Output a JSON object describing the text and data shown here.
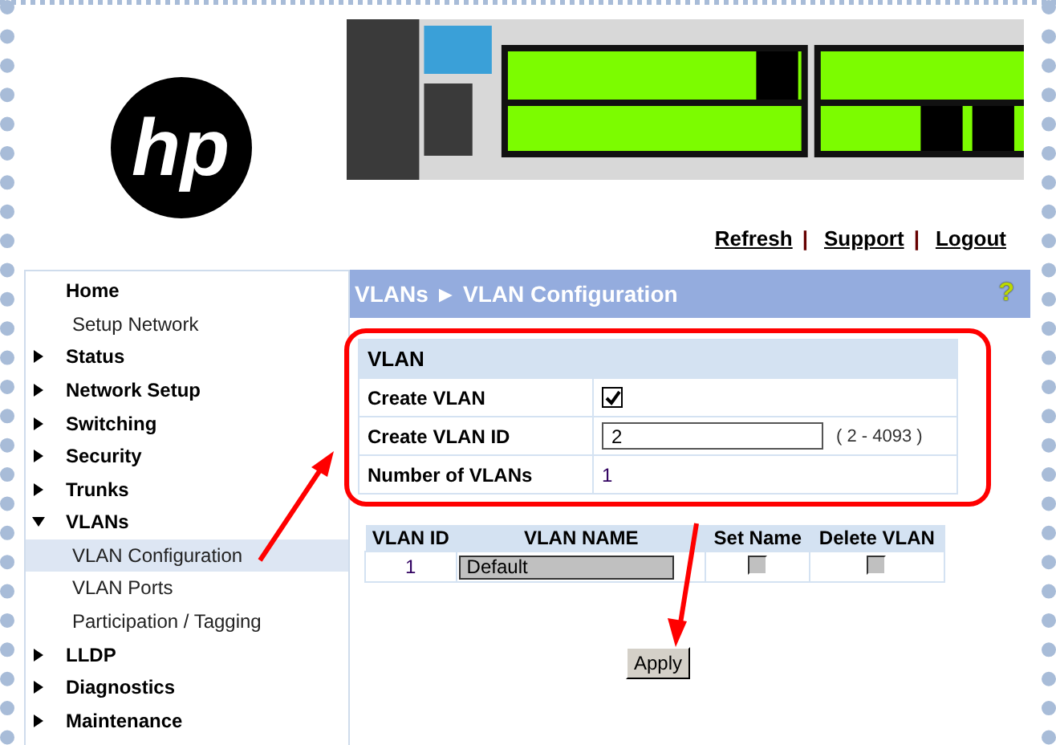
{
  "logo": "hp",
  "header_links": [
    {
      "label": "Refresh"
    },
    {
      "label": "Support"
    },
    {
      "label": "Logout"
    }
  ],
  "link_separator": "|",
  "sidebar": {
    "items": [
      {
        "label": "Home",
        "kind": "plain",
        "selected": false,
        "children": [
          {
            "label": "Setup Network",
            "selected": false
          }
        ]
      },
      {
        "label": "Status",
        "kind": "arrow",
        "expanded": false,
        "selected": false
      },
      {
        "label": "Network Setup",
        "kind": "arrow",
        "expanded": false,
        "selected": false
      },
      {
        "label": "Switching",
        "kind": "arrow",
        "expanded": false,
        "selected": false
      },
      {
        "label": "Security",
        "kind": "arrow",
        "expanded": false,
        "selected": false
      },
      {
        "label": "Trunks",
        "kind": "arrow",
        "expanded": false,
        "selected": false
      },
      {
        "label": "VLANs",
        "kind": "arrow",
        "expanded": true,
        "selected": false,
        "children": [
          {
            "label": "VLAN Configuration",
            "selected": true
          },
          {
            "label": "VLAN Ports",
            "selected": false
          },
          {
            "label": "Participation / Tagging",
            "selected": false
          }
        ]
      },
      {
        "label": "LLDP",
        "kind": "arrow",
        "expanded": false,
        "selected": false
      },
      {
        "label": "Diagnostics",
        "kind": "arrow",
        "expanded": false,
        "selected": false
      },
      {
        "label": "Maintenance",
        "kind": "arrow",
        "expanded": false,
        "selected": false
      }
    ]
  },
  "page_title": "VLANs ► VLAN Configuration",
  "help_icon": "?",
  "vlan_section": {
    "title": "VLAN",
    "rows": [
      {
        "label": "Create VLAN",
        "kind": "checkbox",
        "checked": true
      },
      {
        "label": "Create VLAN ID",
        "kind": "input",
        "value": "2",
        "hint": "( 2 - 4093 )"
      },
      {
        "label": "Number of VLANs",
        "kind": "text",
        "value": "1"
      }
    ]
  },
  "vlan_table": {
    "columns": [
      "VLAN ID",
      "VLAN NAME",
      "Set Name",
      "Delete VLAN"
    ],
    "rows": [
      {
        "id": "1",
        "name": "Default",
        "set_name": false,
        "delete": false
      }
    ]
  },
  "apply_button": "Apply"
}
